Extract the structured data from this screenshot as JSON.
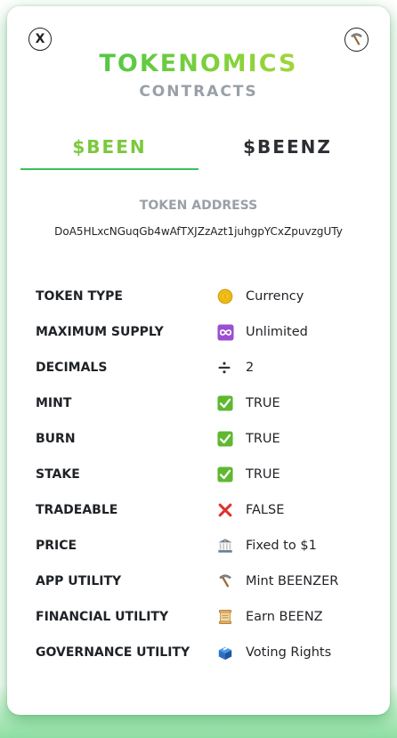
{
  "header": {
    "close_label": "X",
    "title": "TOKENOMICS",
    "subtitle": "CONTRACTS",
    "pick_icon": "pick-icon"
  },
  "tabs": [
    {
      "label": "$BEEN",
      "active": true
    },
    {
      "label": "$BEENZ",
      "active": false
    }
  ],
  "token_address": {
    "label": "TOKEN ADDRESS",
    "value": "DoA5HLxcNGuqGb4wAfTXJZzAzt1juhgpYCxZpuvzgUTy"
  },
  "rows": [
    {
      "label": "TOKEN TYPE",
      "icon": "coin-icon",
      "value": "Currency"
    },
    {
      "label": "MAXIMUM SUPPLY",
      "icon": "infinity-icon",
      "value": "Unlimited"
    },
    {
      "label": "DECIMALS",
      "icon": "divide-icon",
      "value": "2"
    },
    {
      "label": "MINT",
      "icon": "check-icon",
      "value": "TRUE"
    },
    {
      "label": "BURN",
      "icon": "check-icon",
      "value": "TRUE"
    },
    {
      "label": "STAKE",
      "icon": "check-icon",
      "value": "TRUE"
    },
    {
      "label": "TRADEABLE",
      "icon": "cross-icon",
      "value": "FALSE"
    },
    {
      "label": "PRICE",
      "icon": "bank-icon",
      "value": "Fixed to $1"
    },
    {
      "label": "APP UTILITY",
      "icon": "pick-icon",
      "value": "Mint BEENZER"
    },
    {
      "label": "FINANCIAL UTILITY",
      "icon": "scroll-icon",
      "value": "Earn BEENZ"
    },
    {
      "label": "GOVERNANCE UTILITY",
      "icon": "ballot-box-icon",
      "value": "Voting Rights"
    }
  ],
  "colors": {
    "accent_green": "#3cc05a",
    "active_tab": "#7cc83e",
    "muted_gray": "#9aa0a8",
    "dark_text": "#1f2226"
  }
}
